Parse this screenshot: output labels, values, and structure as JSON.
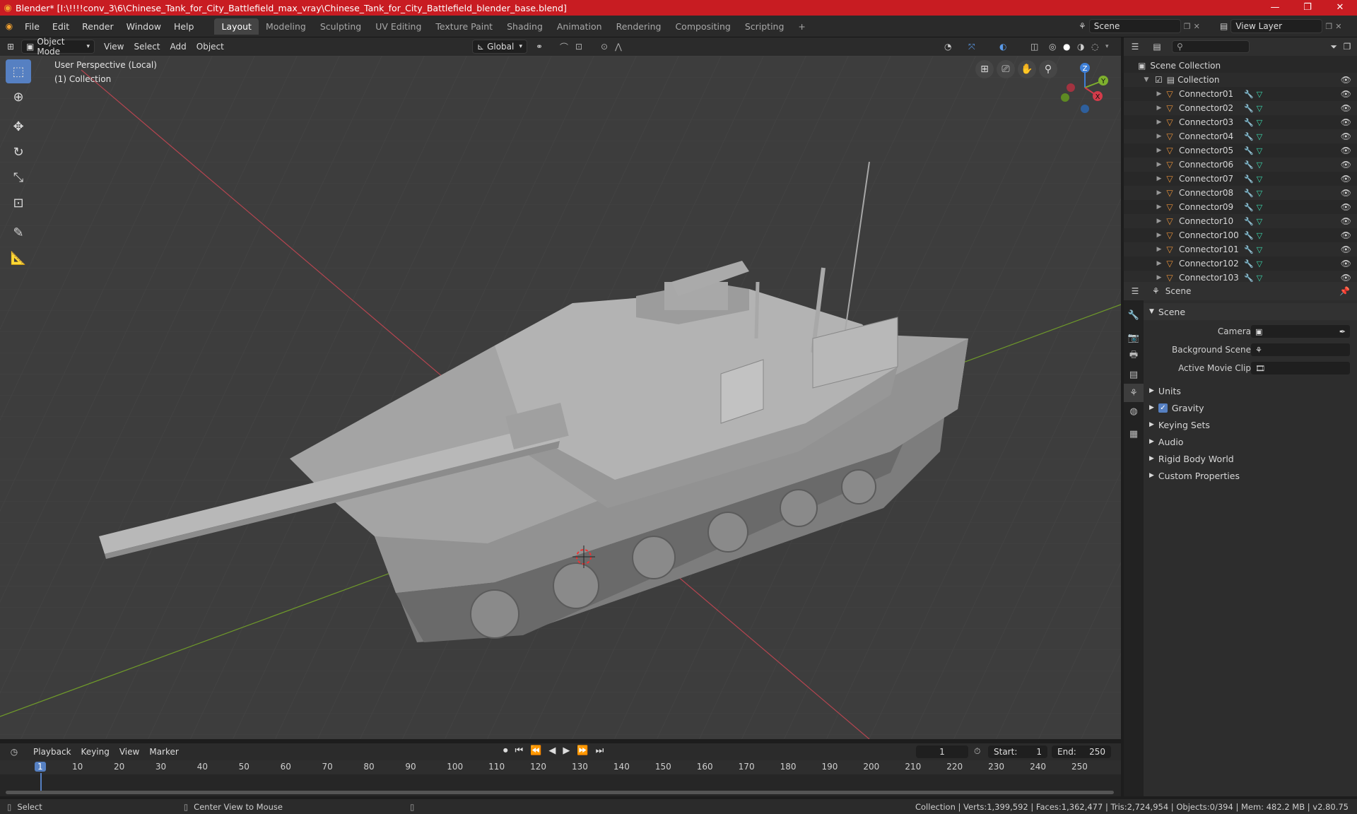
{
  "window": {
    "title": "Blender* [I:\\!!!!conv_3\\6\\Chinese_Tank_for_City_Battlefield_max_vray\\Chinese_Tank_for_City_Battlefield_blender_base.blend]",
    "minimize": "—",
    "maximize": "❐",
    "close": "✕"
  },
  "menu": [
    "File",
    "Edit",
    "Render",
    "Window",
    "Help"
  ],
  "workspaces": [
    "Layout",
    "Modeling",
    "Sculpting",
    "UV Editing",
    "Texture Paint",
    "Shading",
    "Animation",
    "Rendering",
    "Compositing",
    "Scripting"
  ],
  "workspace_add": "+",
  "scene_selector": {
    "label": "Scene"
  },
  "viewlayer_selector": {
    "label": "View Layer"
  },
  "viewport_header": {
    "mode": "Object Mode",
    "menus": [
      "View",
      "Select",
      "Add",
      "Object"
    ],
    "transform_orientation": "Global"
  },
  "viewport": {
    "perspective_label": "User Perspective (Local)",
    "collection_label": "(1) Collection",
    "axes": {
      "x": "X",
      "y": "Y",
      "z": "Z"
    }
  },
  "outliner": {
    "search_placeholder": "",
    "scene_collection": "Scene Collection",
    "collection": "Collection",
    "items": [
      "Connector01",
      "Connector02",
      "Connector03",
      "Connector04",
      "Connector05",
      "Connector06",
      "Connector07",
      "Connector08",
      "Connector09",
      "Connector10",
      "Connector100",
      "Connector101",
      "Connector102",
      "Connector103"
    ]
  },
  "properties": {
    "header": "Scene",
    "section": "Scene",
    "fields": [
      {
        "label": "Camera",
        "value": ""
      },
      {
        "label": "Background Scene",
        "value": ""
      },
      {
        "label": "Active Movie Clip",
        "value": ""
      }
    ],
    "panels": [
      "Units",
      "Gravity",
      "Keying Sets",
      "Audio",
      "Rigid Body World",
      "Custom Properties"
    ],
    "gravity_checked": true
  },
  "timeline": {
    "menus": [
      "Playback",
      "Keying",
      "View",
      "Marker"
    ],
    "current_frame": "1",
    "start_label": "Start:",
    "start": "1",
    "end_label": "End:",
    "end": "250",
    "ticks": [
      "1",
      "10",
      "20",
      "30",
      "40",
      "50",
      "60",
      "70",
      "80",
      "90",
      "100",
      "110",
      "120",
      "130",
      "140",
      "150",
      "160",
      "170",
      "180",
      "190",
      "200",
      "210",
      "220",
      "230",
      "240",
      "250"
    ]
  },
  "status": {
    "left_action": "Select",
    "mid_action": "Center View to Mouse",
    "stats": "Collection | Verts:1,399,592 | Faces:1,362,477 | Tris:2,724,954 | Objects:0/394 | Mem: 482.2 MB | v2.80.75"
  },
  "colors": {
    "titlebar": "#c81c22",
    "active_tool": "#5680c2",
    "x_axis": "#d43b4a",
    "y_axis": "#7eb02e",
    "z_axis": "#3e7fd6"
  }
}
